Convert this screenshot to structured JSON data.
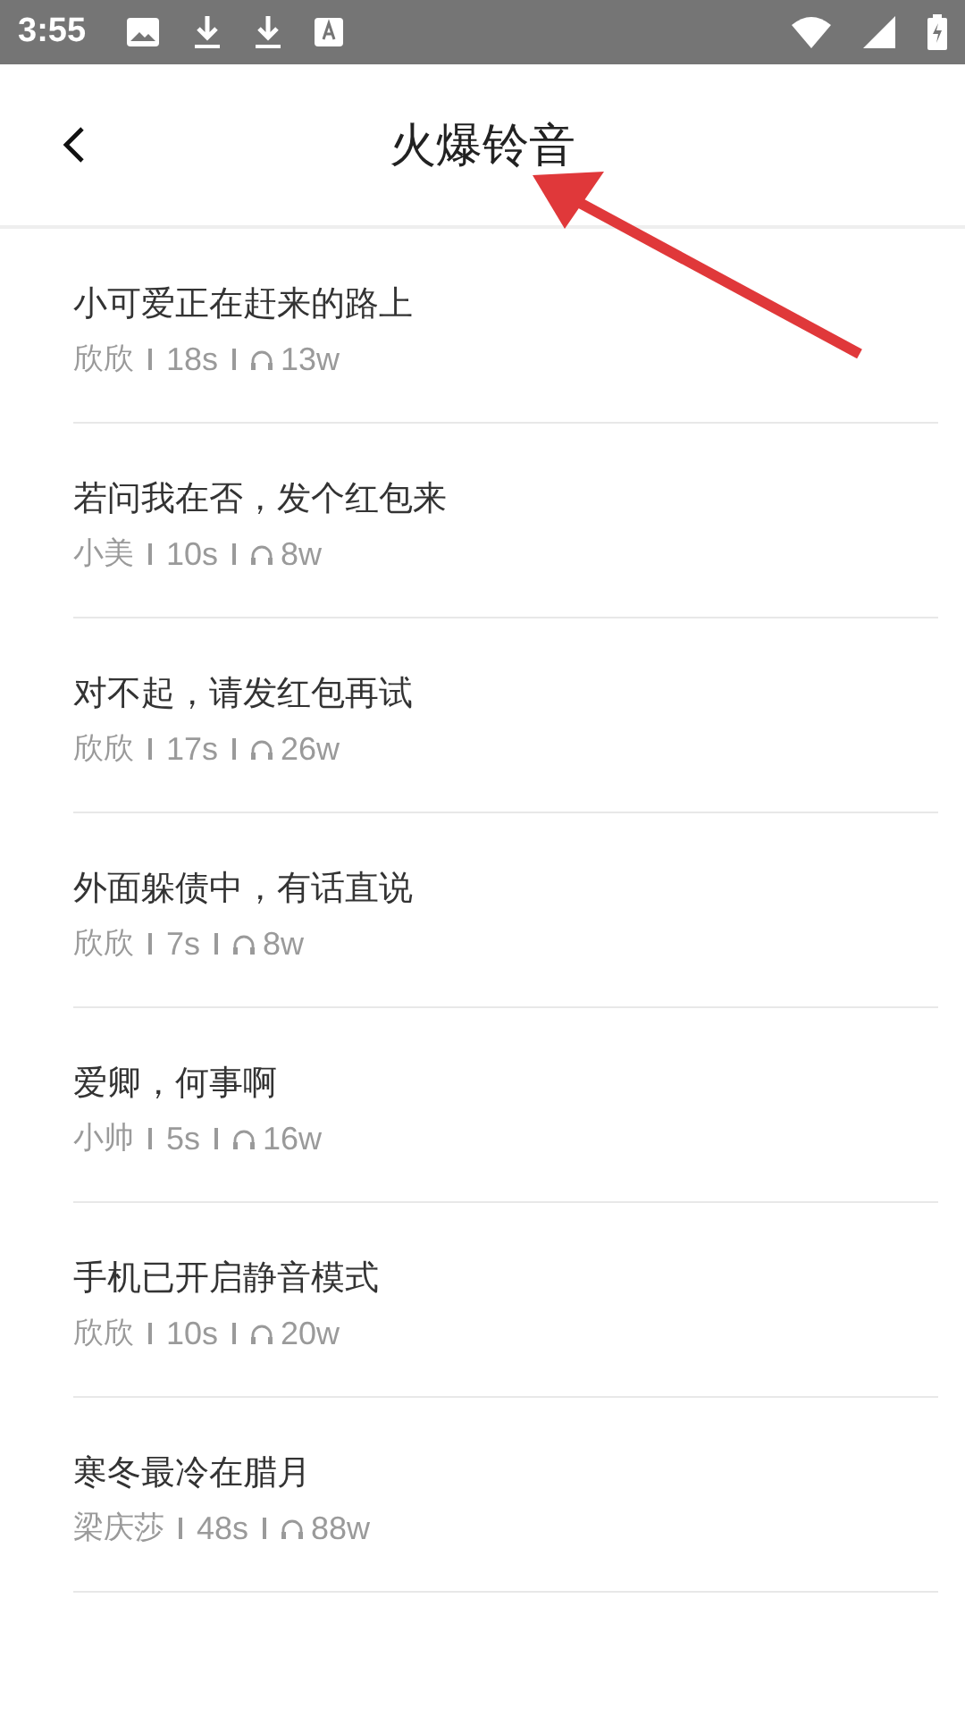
{
  "status_bar": {
    "time": "3:55"
  },
  "header": {
    "title": "火爆铃音"
  },
  "ringtones": [
    {
      "title": "小可爱正在赶来的路上",
      "author": "欣欣",
      "duration": "18s",
      "plays": "13w"
    },
    {
      "title": "若问我在否，发个红包来",
      "author": "小美",
      "duration": "10s",
      "plays": "8w"
    },
    {
      "title": "对不起，请发红包再试",
      "author": "欣欣",
      "duration": "17s",
      "plays": "26w"
    },
    {
      "title": "外面躲债中，有话直说",
      "author": "欣欣",
      "duration": "7s",
      "plays": "8w"
    },
    {
      "title": "爱卿，何事啊",
      "author": "小帅",
      "duration": "5s",
      "plays": "16w"
    },
    {
      "title": "手机已开启静音模式",
      "author": "欣欣",
      "duration": "10s",
      "plays": "20w"
    },
    {
      "title": "寒冬最冷在腊月",
      "author": "梁庆莎",
      "duration": "48s",
      "plays": "88w"
    }
  ]
}
